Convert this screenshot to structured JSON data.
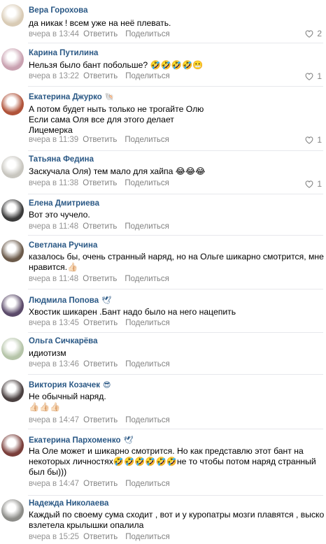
{
  "ui": {
    "reply_label": "Ответить",
    "share_label": "Поделиться"
  },
  "comments": [
    {
      "author": "Вера Горохова",
      "badge": "",
      "lines": [
        "да никак ! всем уже на неё плевать."
      ],
      "time": "вчера в 13:44",
      "likes": "2",
      "avatar_color": "#d9cbb5"
    },
    {
      "author": "Карина Путилина",
      "badge": "",
      "lines": [
        "Нельзя было бант побольше? 🤣🤣🤣🤣😬"
      ],
      "time": "вчера в 13:22",
      "likes": "1",
      "avatar_color": "#c9a1b0"
    },
    {
      "author": "Екатерина Джурко",
      "badge": "🐚",
      "lines": [
        "А потом будет ныть только не трогайте Олю",
        "Если сама Оля все для этого делает",
        "Лицемерка"
      ],
      "time": "вчера в 11:39",
      "likes": "1",
      "avatar_color": "#b0533a"
    },
    {
      "author": "Татьяна Федина",
      "badge": "",
      "lines": [
        "Заскучала Оля) тем мало для хайпа 😂😂😂"
      ],
      "time": "вчера в 11:38",
      "likes": "1",
      "avatar_color": "#c8c6bf"
    },
    {
      "author": "Елена Дмитриева",
      "badge": "",
      "lines": [
        "Вот это чучело."
      ],
      "time": "вчера в 11:48",
      "likes": "",
      "avatar_color": "#3a3a3a"
    },
    {
      "author": "Светлана Ручина",
      "badge": "",
      "lines": [
        "казалось бы, очень странный наряд, но на Ольге шикарно смотрится, мне",
        "нравится.👍🏻"
      ],
      "time": "вчера в 11:48",
      "likes": "",
      "avatar_color": "#6b5a4a"
    },
    {
      "author": "Людмила Попова",
      "badge": "🕊",
      "lines": [
        "Хвостик шикарен .Бант надо было на него нацепить"
      ],
      "time": "вчера в 13:45",
      "likes": "",
      "avatar_color": "#5b4a6a"
    },
    {
      "author": "Ольга Сичкарёва",
      "badge": "",
      "lines": [
        "идиотизм"
      ],
      "time": "вчера в 13:46",
      "likes": "",
      "avatar_color": "#b5c4a8"
    },
    {
      "author": "Виктория Козачек",
      "badge": "😎",
      "lines": [
        "Не обычный наряд.",
        "👍🏻👍🏻👍🏻"
      ],
      "time": "вчера в 14:47",
      "likes": "",
      "avatar_color": "#4a4040"
    },
    {
      "author": "Екатерина Пархоменко",
      "badge": "🕊",
      "lines": [
        "На Оле может и шикарно смотрится. Но как представлю этот бант на",
        "некоторых личностях🤣🤣🤣🤣🤣🤣не то чтобы потом наряд странный",
        "был бы)))"
      ],
      "time": "вчера в 14:47",
      "likes": "",
      "avatar_color": "#7a3e3a"
    },
    {
      "author": "Надежда Николаева",
      "badge": "",
      "lines": [
        "Каждый по своему сума сходит , вот и у куропатры мозги плавятся , выско",
        "взлетела крылышки опалила"
      ],
      "time": "вчера в 15:25",
      "likes": "",
      "avatar_color": "#8c8c88"
    }
  ]
}
